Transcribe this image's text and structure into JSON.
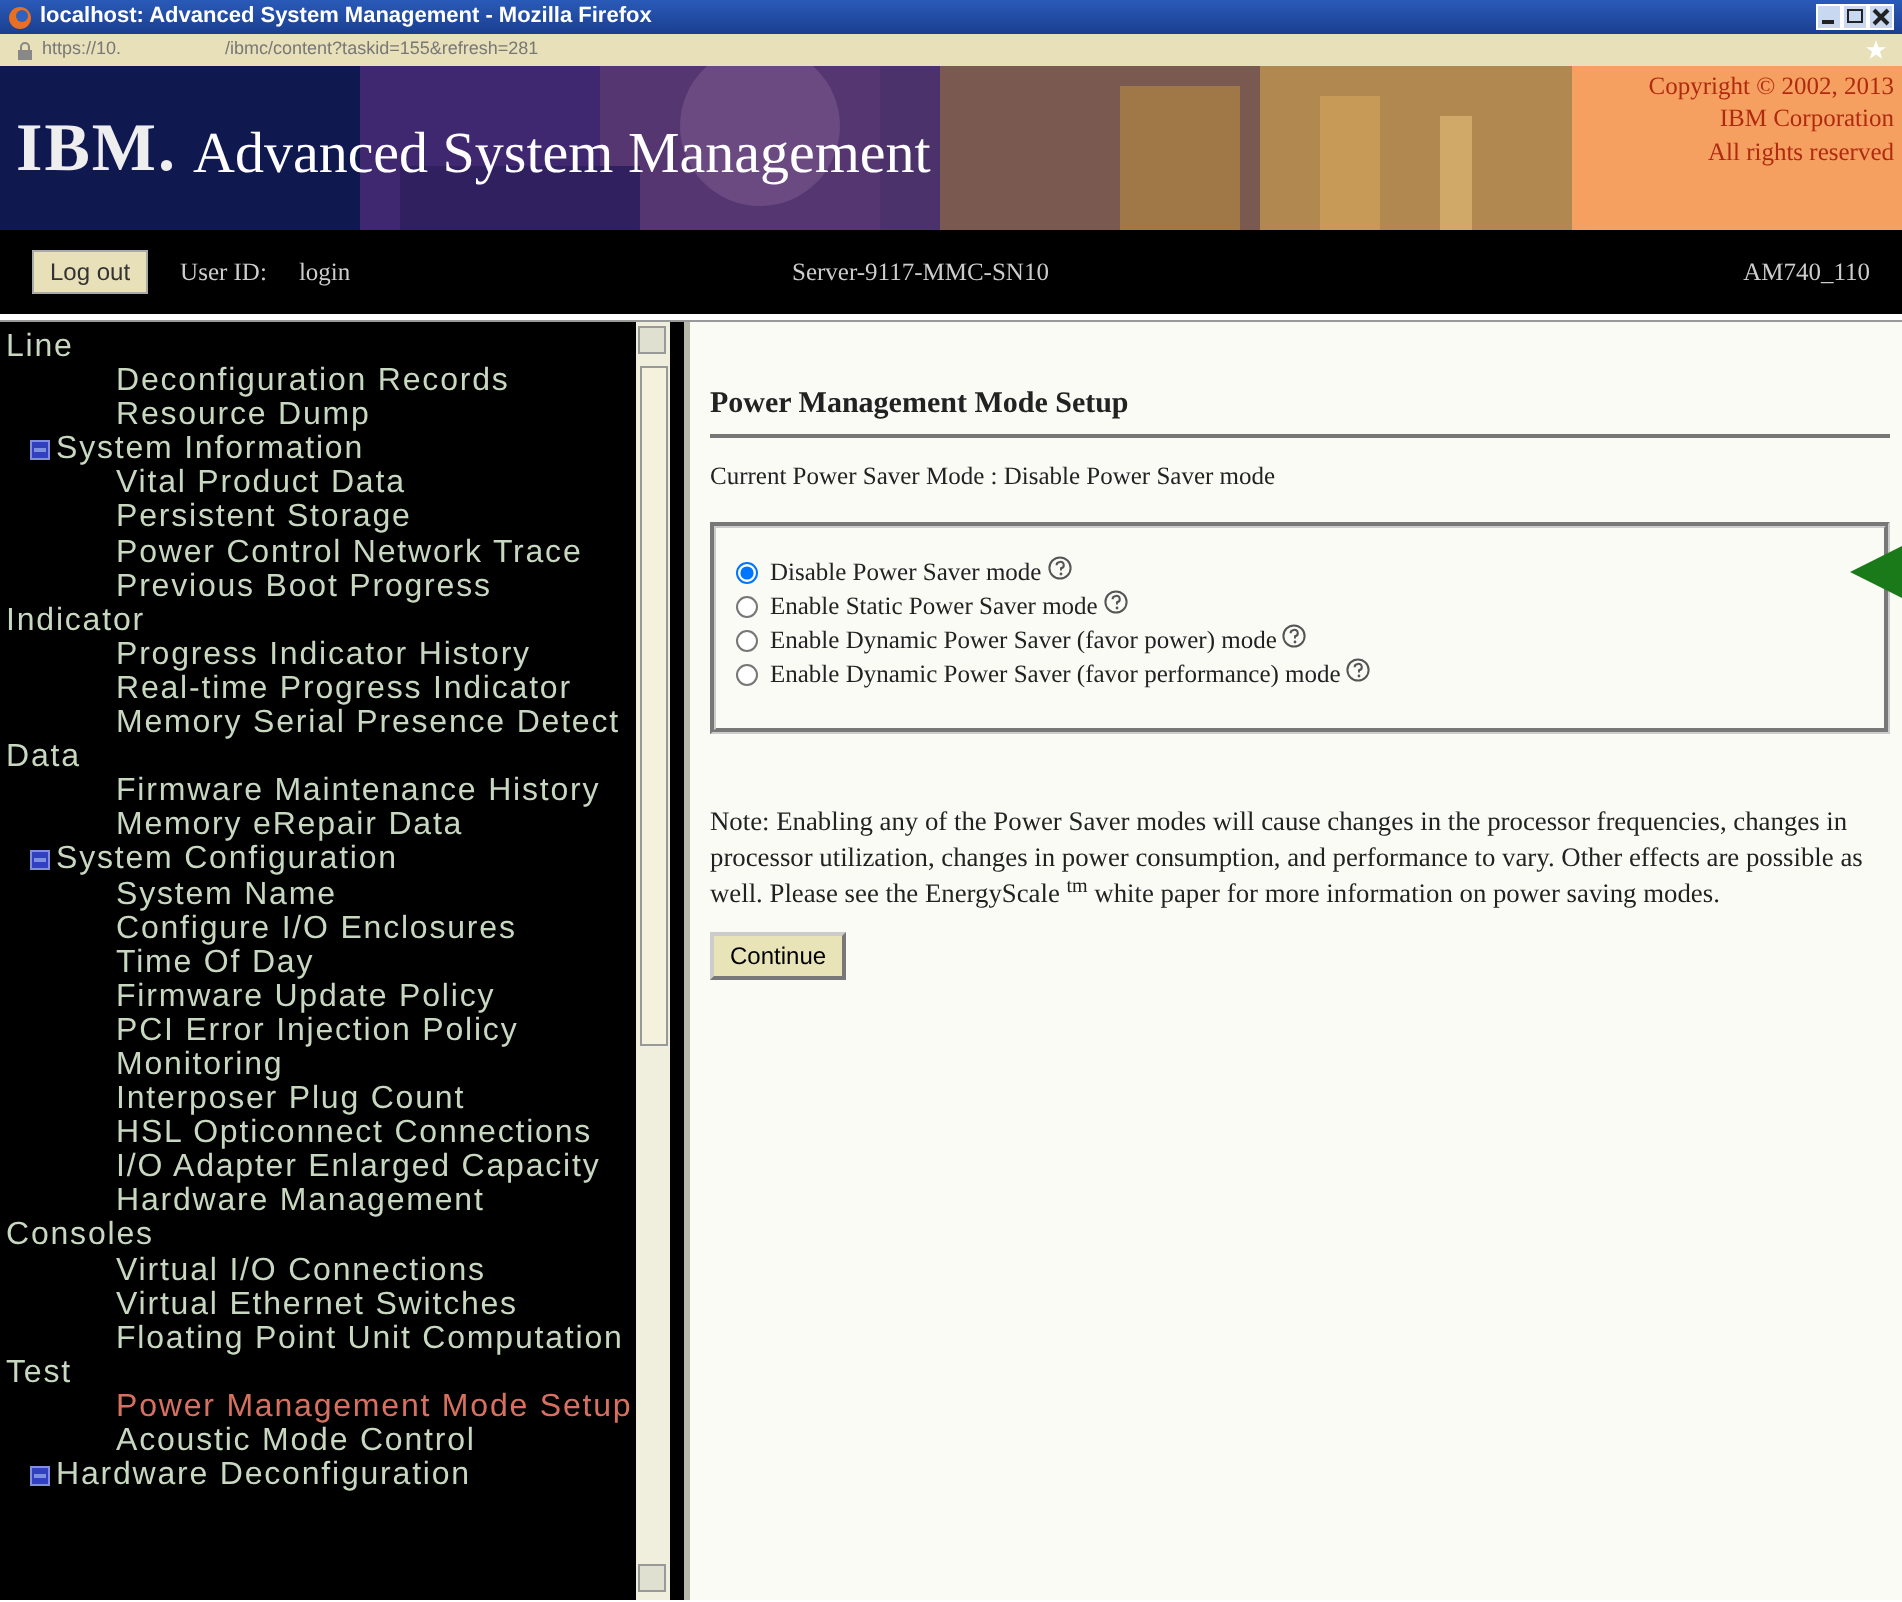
{
  "window": {
    "title": "localhost: Advanced System Management - Mozilla Firefox",
    "url_host": "https://10.",
    "url_path": "/ibmc/content?taskid=155&refresh=281"
  },
  "banner": {
    "logo": "IBM.",
    "title": "Advanced System Management",
    "copyright": [
      "Copyright © 2002, 2013",
      "IBM Corporation",
      "All rights reserved"
    ]
  },
  "nav": {
    "logout": "Log out",
    "user_label": "User ID:",
    "user": "login",
    "server": "Server-9117-MMC-SN10",
    "machine": "AM740_110"
  },
  "sidebar": {
    "items": [
      {
        "label": "Line",
        "kind": "continuation",
        "selected": false
      },
      {
        "label": "Deconfiguration Records",
        "kind": "link",
        "selected": false
      },
      {
        "label": "Resource Dump",
        "kind": "link",
        "selected": false
      },
      {
        "label": "System Information",
        "kind": "group",
        "selected": false
      },
      {
        "label": "Vital Product Data",
        "kind": "link",
        "selected": false
      },
      {
        "label": "Persistent Storage",
        "kind": "link",
        "selected": false
      },
      {
        "label": "Power Control Network Trace",
        "kind": "link",
        "selected": false
      },
      {
        "label": "Previous Boot Progress Indicator",
        "kind": "link",
        "selected": false
      },
      {
        "label": "Progress Indicator History",
        "kind": "link",
        "selected": false
      },
      {
        "label": "Real-time Progress Indicator",
        "kind": "link",
        "selected": false
      },
      {
        "label": "Memory Serial Presence Detect Data",
        "kind": "link",
        "selected": false
      },
      {
        "label": "Firmware Maintenance History",
        "kind": "link",
        "selected": false
      },
      {
        "label": "Memory eRepair Data",
        "kind": "link",
        "selected": false
      },
      {
        "label": "System Configuration",
        "kind": "group",
        "selected": false
      },
      {
        "label": "System Name",
        "kind": "link",
        "selected": false
      },
      {
        "label": "Configure I/O Enclosures",
        "kind": "link",
        "selected": false
      },
      {
        "label": "Time Of Day",
        "kind": "link",
        "selected": false
      },
      {
        "label": "Firmware Update Policy",
        "kind": "link",
        "selected": false
      },
      {
        "label": "PCI Error Injection Policy",
        "kind": "link",
        "selected": false
      },
      {
        "label": "Monitoring",
        "kind": "link",
        "selected": false
      },
      {
        "label": "Interposer Plug Count",
        "kind": "link",
        "selected": false
      },
      {
        "label": "HSL Opticonnect Connections",
        "kind": "link",
        "selected": false
      },
      {
        "label": "I/O Adapter Enlarged Capacity",
        "kind": "link",
        "selected": false
      },
      {
        "label": "Hardware Management Consoles",
        "kind": "link",
        "selected": false
      },
      {
        "label": "Virtual I/O Connections",
        "kind": "link",
        "selected": false
      },
      {
        "label": "Virtual Ethernet Switches",
        "kind": "link",
        "selected": false
      },
      {
        "label": "Floating Point Unit Computation Test",
        "kind": "link",
        "selected": false
      },
      {
        "label": "Power Management Mode Setup",
        "kind": "link",
        "selected": true
      },
      {
        "label": "Acoustic Mode Control",
        "kind": "link",
        "selected": false
      },
      {
        "label": "Hardware Deconfiguration",
        "kind": "group",
        "selected": false
      }
    ]
  },
  "content": {
    "heading": "Power Management Mode Setup",
    "current": "Current Power Saver Mode : Disable Power Saver mode",
    "options": [
      {
        "label": "Disable Power Saver mode",
        "selected": true
      },
      {
        "label": "Enable Static Power Saver mode",
        "selected": false
      },
      {
        "label": "Enable Dynamic Power Saver (favor power) mode",
        "selected": false
      },
      {
        "label": "Enable Dynamic Power Saver (favor performance) mode",
        "selected": false
      }
    ],
    "note": "Note: Enabling any of the Power Saver modes will cause changes in the processor frequencies, changes in processor utilization, changes in power consumption, and performance to vary. Other effects are possible as well. Please see the EnergyScale $^{tm}$ white paper for more information on power saving modes.",
    "button": "Continue"
  }
}
